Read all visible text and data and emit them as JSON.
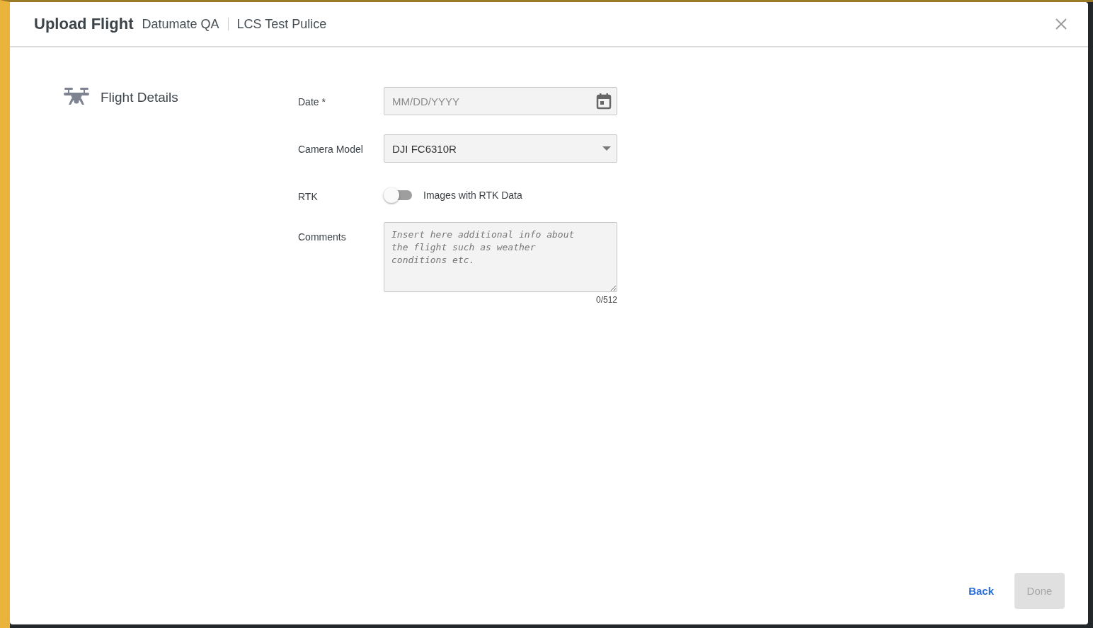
{
  "dialog": {
    "title": "Upload Flight",
    "breadcrumbs": [
      "Datumate QA",
      "LCS Test Pulice"
    ]
  },
  "section": {
    "title": "Flight Details"
  },
  "fields": [
    {
      "kind": "date",
      "label": "Date *",
      "placeholder": "MM/DD/YYYY"
    },
    {
      "kind": "select",
      "label": "Camera Model",
      "value": "DJI FC6310R"
    },
    {
      "kind": "toggle",
      "label": "RTK",
      "on": false,
      "text": "Images with RTK Data"
    },
    {
      "kind": "textarea",
      "label": "Comments",
      "placeholder": "Insert here additional info about the flight such as weather conditions etc.",
      "counter": "0/512"
    }
  ],
  "buttons": [
    {
      "label": "Back",
      "kind": "text",
      "disabled": false
    },
    {
      "label": "Done",
      "kind": "filled",
      "disabled": true
    }
  ]
}
